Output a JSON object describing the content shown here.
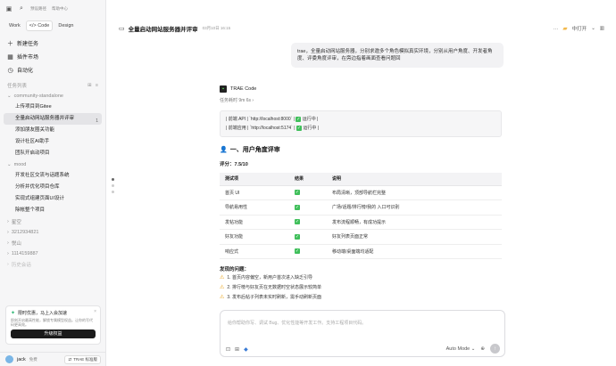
{
  "topbar": {
    "label_a": "预设路径",
    "label_b": "帮助中心"
  },
  "modes": [
    {
      "label": "Work"
    },
    {
      "label": "</> Code"
    },
    {
      "label": "Design"
    }
  ],
  "nav": [
    {
      "label": "新建任务",
      "icon": "plus-icon"
    },
    {
      "label": "插件市场",
      "icon": "grid-icon"
    },
    {
      "label": "自动化",
      "icon": "clock-icon"
    }
  ],
  "tasks_section": {
    "label": "任务列表"
  },
  "groups": [
    {
      "name": "community-standalone",
      "tasks": [
        "上传项目到Gitee",
        "全量启动网站服务器并评审",
        "添加朋友圈关功能",
        "设计社区AI助手",
        "团队开启动项目"
      ]
    },
    {
      "name": "mood",
      "tasks": [
        "开发社区交流与话题系统",
        "分析并优化项目仓库",
        "实现式组建页面UI设计",
        "除帐整个项目"
      ]
    },
    {
      "name": "星空",
      "tasks": []
    },
    {
      "name": "3212934821",
      "tasks": []
    },
    {
      "name": "悦山",
      "tasks": []
    },
    {
      "name": "1114159887",
      "tasks": []
    },
    {
      "name": "历史会话",
      "tasks": []
    }
  ],
  "active_task_badge": "1",
  "promo": {
    "title": "限时优惠，马上入会加速",
    "desc": "即刻开启最高性能，解锁专属模型权益。让你的写代码更高效。",
    "button": "升级权益",
    "close": "×"
  },
  "user": {
    "name": "jack",
    "plan": "免费",
    "switch_label": "TRAE 标准版"
  },
  "header": {
    "title": "全量启动网站服务器并评审",
    "timestamp": "03月10日 16:15",
    "more": "…",
    "project": "中打开"
  },
  "user_message": "trae，全量启动网站服务器，分别求邀多个角色模拟真实环境，分别从用户角度、开发者角度、评委角度评审，在旁边指着画面查看问题回",
  "agent": {
    "name": "TRAE Code",
    "elapsed": "任务耗时 9m 6s ›",
    "code_lines": [
      {
        "prefix": "| 前端 API | `http://localhost:8000` |",
        "status": "运行中 |"
      },
      {
        "prefix": "| 前端应用 | `http://localhost:5174` |",
        "status": "运行中 |"
      }
    ],
    "heading_icon": "👤",
    "heading": "一、用户角度评审",
    "score": "评分：7.5/10",
    "table": {
      "headers": [
        "测试项",
        "结果",
        "说明"
      ],
      "rows": [
        [
          "首页 UI",
          "✓",
          "布局清晰，顶部导航栏完整"
        ],
        [
          "导航易用性",
          "✓",
          "广场/话题/排行榜/我的 入口可识别"
        ],
        [
          "发帖功能",
          "✓",
          "发布流程顺畅，有成功提示"
        ],
        [
          "好友功能",
          "✓",
          "好友列表页面正常"
        ],
        [
          "响应式",
          "✓",
          "移动端/桌面端均适配"
        ]
      ]
    },
    "issues_title": "发现的问题：",
    "issues": [
      "1. 首页内容偏空，新用户首次进入缺乏引导",
      "2. 排行榜与好友页在无数据时空状态展示较简单",
      "3. 发布后帖子列表未实时刷新，需手动刷新页面"
    ]
  },
  "input": {
    "placeholder": "给你帮助你写、调试 Bug、优化性能等开发工作。支持工程项目代码。",
    "mode": "Auto Mode ⌄",
    "send": "↑"
  }
}
